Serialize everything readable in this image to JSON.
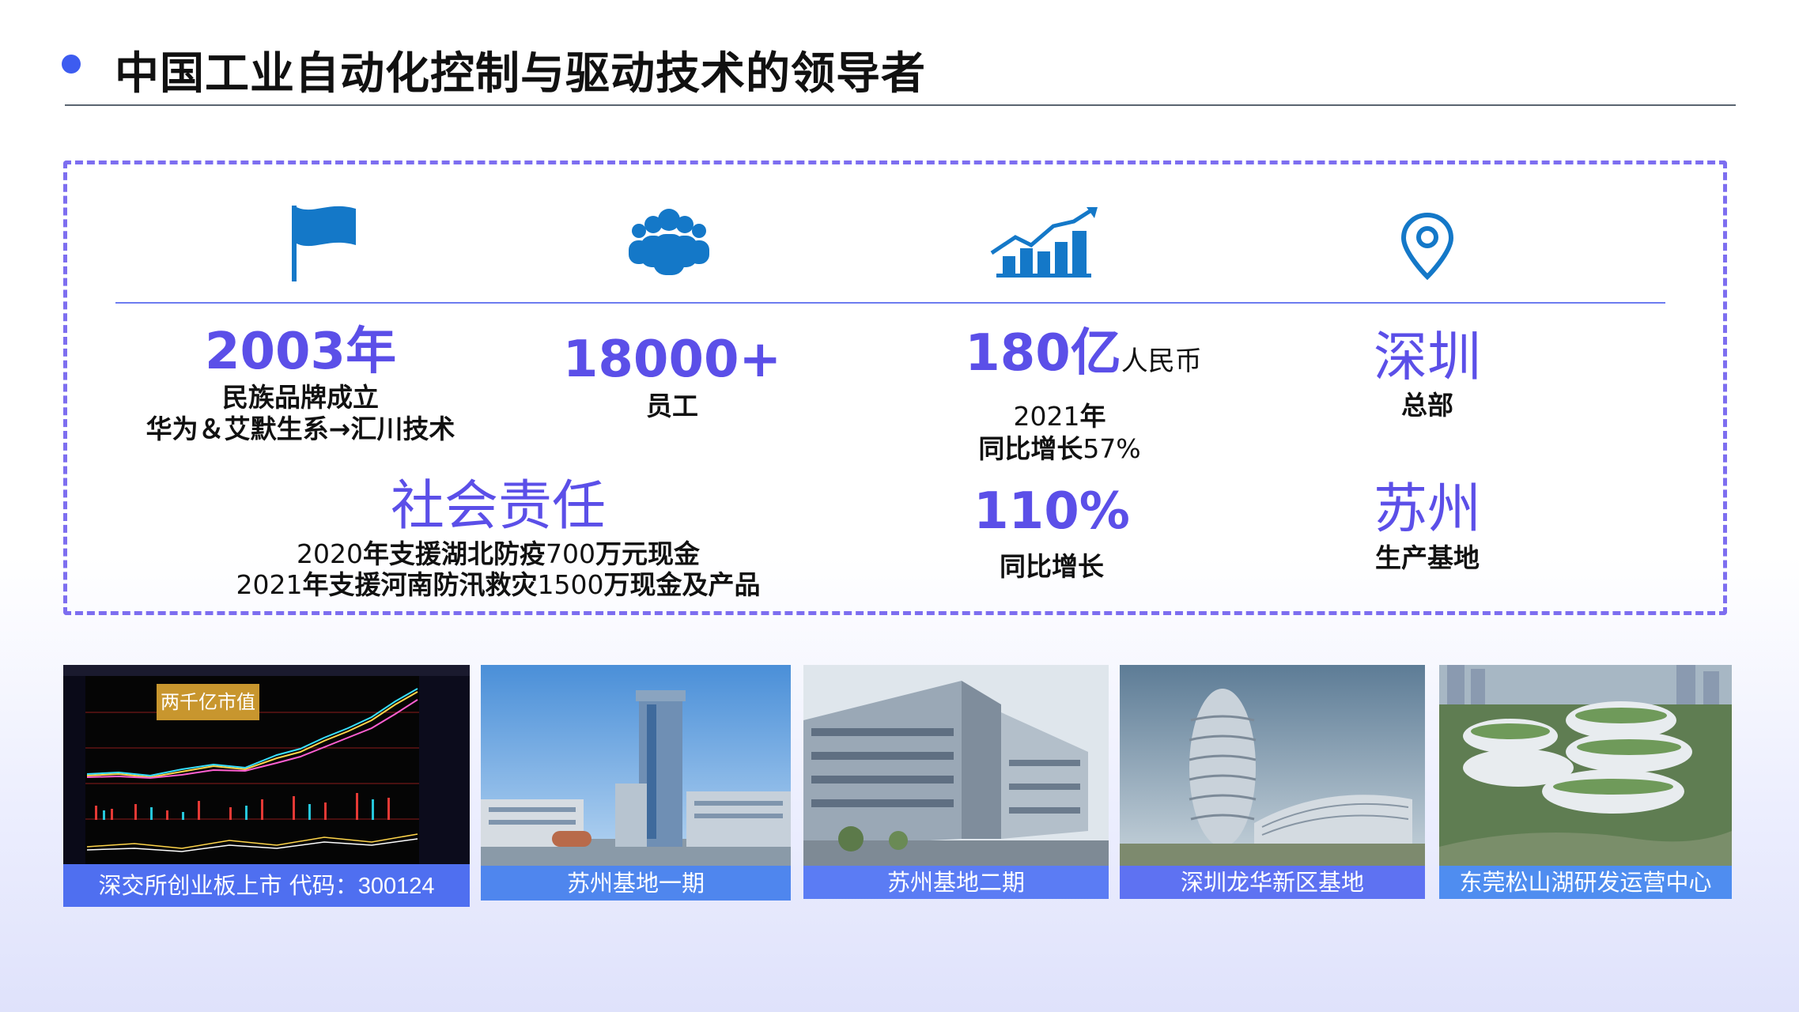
{
  "header": {
    "title": "中国工业自动化控制与驱动技术的领导者"
  },
  "colors": {
    "accent": "#5b4fe8",
    "icon_blue": "#1478c8",
    "caption_blue": "#4f7ff0",
    "dash": "#7d6ef0"
  },
  "stats": {
    "founded": {
      "icon": "flag-icon",
      "value": "2003年",
      "line1": "民族品牌成立",
      "line2": "华为＆艾默生系→汇川技术"
    },
    "employees": {
      "icon": "people-icon",
      "value": "18000+",
      "label": "员工"
    },
    "revenue": {
      "icon": "growth-chart-icon",
      "value": "180亿",
      "unit": "人民币",
      "year_num": "2021",
      "year_text": "年",
      "growth_text": "同比增长",
      "growth_num": "57%"
    },
    "hq": {
      "icon": "location-pin-icon",
      "value": "深圳",
      "label": "总部"
    },
    "csr": {
      "value": "社会责任",
      "l1_year": "2020",
      "l1_a": "年支援湖北防疫",
      "l1_num": "700",
      "l1_b": "万元现金",
      "l2_year": "2021",
      "l2_a": "年支援河南防汛救灾",
      "l2_num": "1500",
      "l2_b": "万现金及产品"
    },
    "growth": {
      "value": "110%",
      "label": "同比增长"
    },
    "production": {
      "value": "苏州",
      "label": "生产基地"
    }
  },
  "photos": [
    {
      "caption_a": "深交所创业板上市 代码：",
      "caption_b": "300124",
      "badge": "两千亿市值",
      "icon": "stock-chart-image"
    },
    {
      "caption": "苏州基地一期",
      "icon": "suzhou-phase1-image"
    },
    {
      "caption": "苏州基地二期",
      "icon": "suzhou-phase2-image"
    },
    {
      "caption": "深圳龙华新区基地",
      "icon": "longhua-base-image"
    },
    {
      "caption": "东莞松山湖研发运营中心",
      "icon": "songshan-lake-image"
    }
  ]
}
